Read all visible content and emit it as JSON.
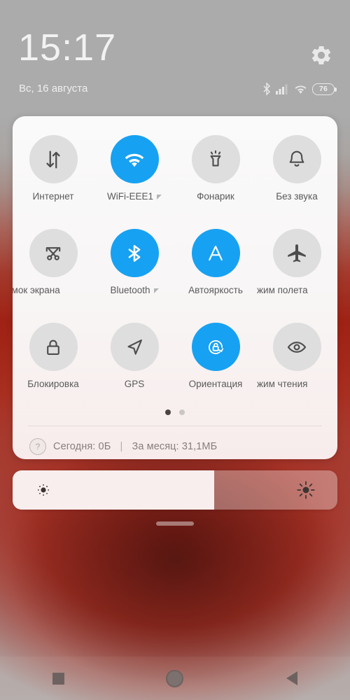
{
  "status": {
    "clock": "15:17",
    "date": "Вс, 16 августа",
    "battery_level": "76",
    "settings_icon": "gear-icon",
    "icons": [
      "bluetooth-icon",
      "cellular-signal-icon",
      "wifi-icon",
      "battery-icon"
    ]
  },
  "quick_settings": {
    "tiles": [
      {
        "label": "Интернет",
        "icon": "data-transfer-icon",
        "active": false,
        "expandable": false,
        "clip": "none"
      },
      {
        "label": "WiFi-EEE1",
        "icon": "wifi-icon",
        "active": true,
        "expandable": true,
        "clip": "none"
      },
      {
        "label": "Фонарик",
        "icon": "flashlight-icon",
        "active": false,
        "expandable": false,
        "clip": "none"
      },
      {
        "label": "Без звука",
        "icon": "bell-icon",
        "active": false,
        "expandable": false,
        "clip": "none"
      },
      {
        "label": "имок экрана",
        "icon": "screenshot-icon",
        "active": false,
        "expandable": false,
        "clip": "left"
      },
      {
        "label": "Bluetooth",
        "icon": "bluetooth-icon",
        "active": true,
        "expandable": true,
        "clip": "none"
      },
      {
        "label": "Автояркость",
        "icon": "auto-brightness-icon",
        "active": true,
        "expandable": false,
        "clip": "none"
      },
      {
        "label": "жим полета",
        "icon": "airplane-icon",
        "active": false,
        "expandable": false,
        "clip": "right"
      },
      {
        "label": "Блокировка",
        "icon": "lock-icon",
        "active": false,
        "expandable": false,
        "clip": "none"
      },
      {
        "label": "GPS",
        "icon": "navigation-arrow-icon",
        "active": false,
        "expandable": false,
        "clip": "none"
      },
      {
        "label": "Ориентация",
        "icon": "rotation-lock-icon",
        "active": true,
        "expandable": false,
        "clip": "none"
      },
      {
        "label": "жим чтения",
        "icon": "eye-icon",
        "active": false,
        "expandable": false,
        "clip": "right"
      }
    ],
    "pages": {
      "count": 2,
      "active_index": 0
    },
    "data_usage": {
      "help_icon": "question-mark-icon",
      "today_label": "Сегодня: 0Б",
      "separator": "|",
      "month_label": "За месяц: 31,1МБ"
    }
  },
  "brightness": {
    "value_percent": 62,
    "low_icon": "brightness-low-icon",
    "high_icon": "brightness-high-icon"
  },
  "navbar": {
    "recents": "recents-square-icon",
    "home": "home-circle-icon",
    "back": "back-triangle-icon"
  },
  "colors": {
    "accent_blue": "#17a1f2",
    "tile_inactive": "#dedede",
    "panel_bg": "#faf8f7",
    "wallpaper_red": "#a3281a",
    "status_gray": "#ababab"
  }
}
